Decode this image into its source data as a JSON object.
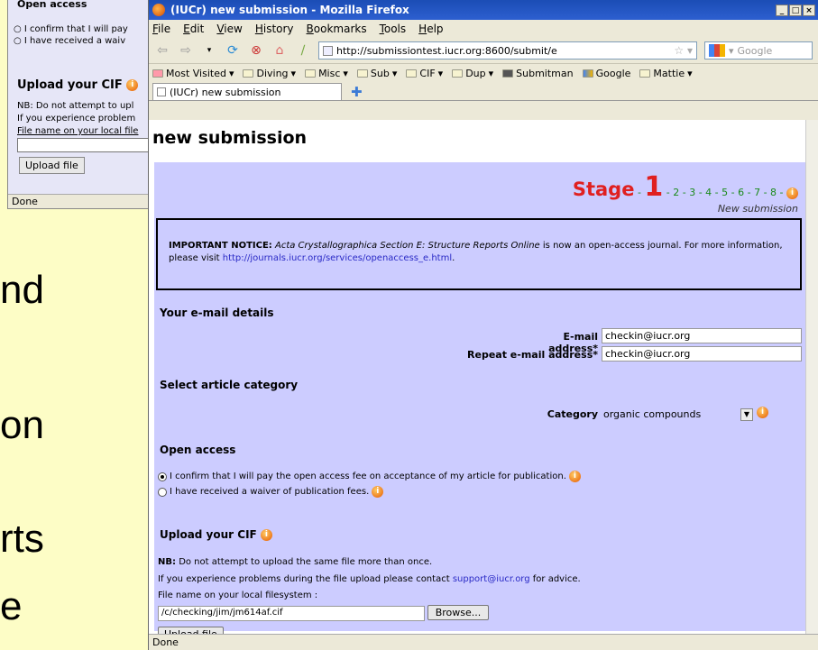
{
  "slide": {
    "lines": [
      "nd",
      "on",
      "rts",
      "e"
    ]
  },
  "bg_window": {
    "section": "Open access",
    "radio1": "I confirm that I will pay",
    "radio2": "I have received a waiv",
    "upload_title": "Upload your CIF",
    "nb": "NB: Do not attempt to upl",
    "problems": "If you experience problem",
    "filename": "File name on your local file",
    "upload_btn": "Upload file",
    "status": "Done"
  },
  "window": {
    "title": "(IUCr) new submission - Mozilla Firefox",
    "buttons": [
      "_",
      "□",
      "×"
    ]
  },
  "menu": [
    "File",
    "Edit",
    "View",
    "History",
    "Bookmarks",
    "Tools",
    "Help"
  ],
  "nav": {
    "url": "http://submissiontest.iucr.org:8600/submit/e",
    "search_placeholder": "Google"
  },
  "bookmarks": [
    "Most Visited",
    "Diving",
    "Misc",
    "Sub",
    "CIF",
    "Dup",
    "Submitman",
    "Google",
    "Mattie"
  ],
  "tab": {
    "label": "(IUCr) new submission"
  },
  "page": {
    "heading": "new submission",
    "stage": {
      "label": "Stage",
      "current": "1",
      "steps": "- 2 - 3 - 4 - 5 - 6 - 7 - 8 -",
      "sub": "New submission"
    },
    "notice": {
      "bold": "IMPORTANT NOTICE:",
      "italic": "Acta Crystallographica Section E: Structure Reports Online",
      "text": "is now an open-access journal. For more information, please visit",
      "link": "http://journals.iucr.org/services/openaccess_e.html",
      "end": "."
    },
    "email_section": "Your e-mail details",
    "email_label": "E-mail address*",
    "email_value": "checkin@iucr.org",
    "repeat_label": "Repeat e-mail address*",
    "repeat_value": "checkin@iucr.org",
    "category_section": "Select article category",
    "category_label": "Category",
    "category_value": "organic compounds",
    "oa_section": "Open access",
    "oa_option1": "I confirm that I will pay the open access fee on acceptance of my article for publication.",
    "oa_option2": "I have received a waiver of publication fees.",
    "upload_section": "Upload your CIF",
    "nb_bold": "NB:",
    "nb_text": "Do not attempt to upload the same file more than once.",
    "problems_text": "If you experience problems during the file upload please contact",
    "problems_link": "support@iucr.org",
    "problems_end": "for advice.",
    "filename_label": "File name on your local filesystem :",
    "filename_value": "/c/checking/jim/jm614af.cif",
    "browse": "Browse...",
    "upload_btn": "Upload file"
  },
  "status": "Done"
}
